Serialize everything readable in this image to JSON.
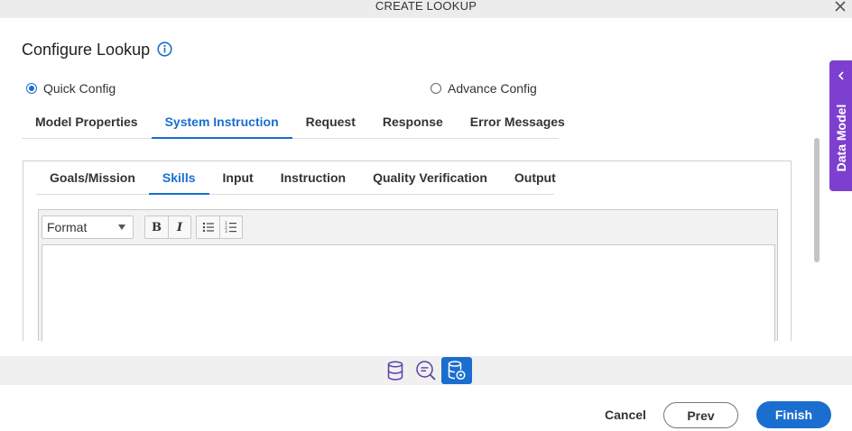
{
  "window": {
    "title": "CREATE LOOKUP"
  },
  "page": {
    "heading": "Configure Lookup"
  },
  "config_mode": {
    "quick_label": "Quick Config",
    "advance_label": "Advance Config",
    "selected": "Quick Config"
  },
  "main_tabs": [
    {
      "label": "Model Properties"
    },
    {
      "label": "System Instruction"
    },
    {
      "label": "Request"
    },
    {
      "label": "Response"
    },
    {
      "label": "Error Messages"
    }
  ],
  "main_tabs_active": "System Instruction",
  "sub_tabs": [
    {
      "label": "Goals/Mission"
    },
    {
      "label": "Skills"
    },
    {
      "label": "Input"
    },
    {
      "label": "Instruction"
    },
    {
      "label": "Quality Verification"
    },
    {
      "label": "Output"
    }
  ],
  "sub_tabs_active": "Skills",
  "editor": {
    "format_value": "Format",
    "bold_label": "B",
    "italic_label": "I",
    "content": ""
  },
  "side_panel": {
    "label": "Data Model"
  },
  "icon_bar": {
    "icons": [
      "database-icon",
      "search-chat-icon",
      "database-settings-icon"
    ],
    "selected": "database-settings-icon"
  },
  "footer": {
    "cancel_label": "Cancel",
    "prev_label": "Prev",
    "finish_label": "Finish"
  },
  "colors": {
    "accent": "#1a6ecf",
    "side_panel": "#7d3fcf",
    "titlebar": "#ececec"
  }
}
